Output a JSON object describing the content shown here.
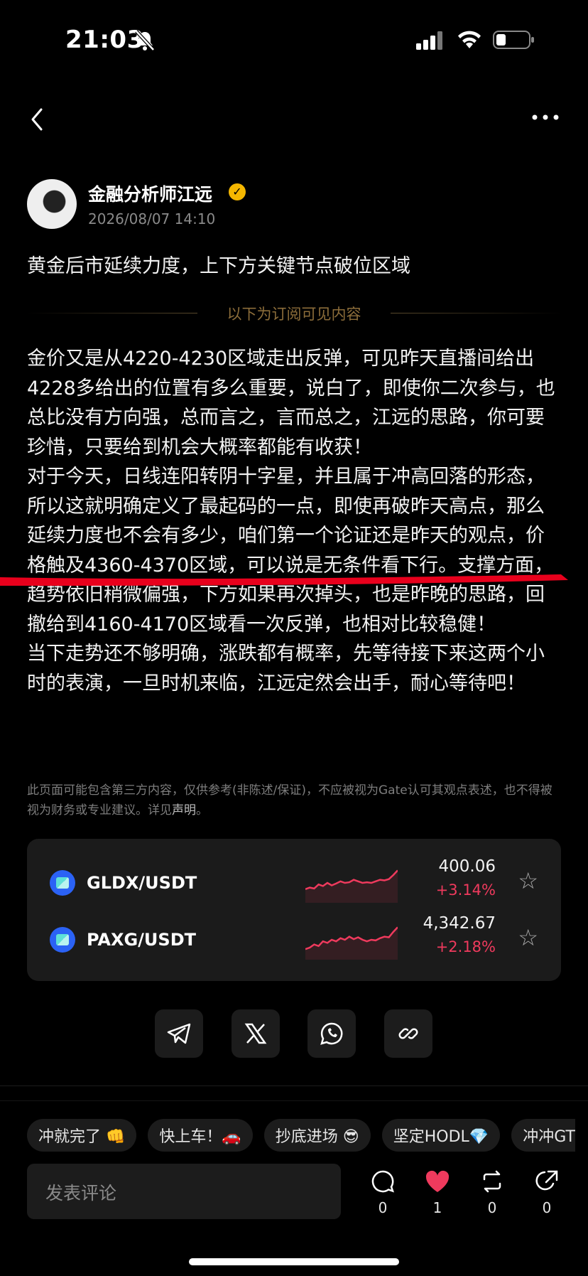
{
  "status_bar": {
    "time": "21:03"
  },
  "post": {
    "author": "金融分析师江远",
    "date": "2026/08/07 14:10",
    "title": "黄金后市延续力度，上下方关键节点破位区域",
    "subscription_divider": "以下为订阅可见内容",
    "paragraphs": [
      "金价又是从4220-4230区域走出反弹，可见昨天直播间给出4228多给出的位置有多么重要，说白了，即使你二次参与，也总比没有方向强，总而言之，言而总之，江远的思路，你可要珍惜，只要给到机会大概率都能有收获！",
      "对于今天，日线连阳转阴十字星，并且属于冲高回落的形态，所以这就明确定义了最起码的一点，即使再破昨天高点，那么延续力度也不会有多少，咱们第一个论证还是昨天的观点，价格触及4360-4370区域，可以说是无条件看下行。支撑方面，趋势依旧稍微偏强，下方如果再次掉头，也是昨晚的思路，回撤给到4160-4170区域看一次反弹，也相对比较稳健！",
      "当下走势还不够明确，涨跌都有概率，先等待接下来这两个小时的表演，一旦时机来临，江远定然会出手，耐心等待吧！"
    ],
    "disclaimer": "此页面可能包含第三方内容，仅供参考(非陈述/保证)，不应被视为Gate认可其观点表述，也不得被视为财务或专业建议。详见",
    "disclaimer_link": "声明",
    "disclaimer_end": "。"
  },
  "markets": [
    {
      "pair": "GLDX/USDT",
      "price": "400.06",
      "change": "+3.14%",
      "trend": [
        0.3,
        0.35,
        0.32,
        0.45,
        0.4,
        0.5,
        0.42,
        0.48,
        0.55,
        0.5,
        0.52,
        0.6,
        0.55,
        0.5,
        0.52,
        0.5,
        0.55,
        0.6,
        0.58,
        0.62,
        0.75,
        0.9
      ]
    },
    {
      "pair": "PAXG/USDT",
      "price": "4,342.67",
      "change": "+2.18%",
      "trend": [
        0.2,
        0.25,
        0.35,
        0.3,
        0.45,
        0.4,
        0.5,
        0.45,
        0.55,
        0.5,
        0.6,
        0.52,
        0.58,
        0.5,
        0.45,
        0.5,
        0.48,
        0.55,
        0.6,
        0.58,
        0.75,
        0.9
      ]
    }
  ],
  "share_icons": [
    "telegram-icon",
    "x-icon",
    "whatsapp-icon",
    "link-icon"
  ],
  "reactions": [
    "冲就完了 👊",
    "快上车！🚗",
    "抄底进场 😎",
    "坚定HODL💎",
    "冲冲GT"
  ],
  "comment": {
    "placeholder": "发表评论"
  },
  "actions": [
    {
      "name": "comment",
      "count": "0"
    },
    {
      "name": "like",
      "count": "1"
    },
    {
      "name": "repost",
      "count": "0"
    },
    {
      "name": "share",
      "count": "0"
    }
  ],
  "colors": {
    "accent_red": "#ef3a5d",
    "verified": "#f5b700",
    "divider_gold": "#8c6d3a"
  }
}
